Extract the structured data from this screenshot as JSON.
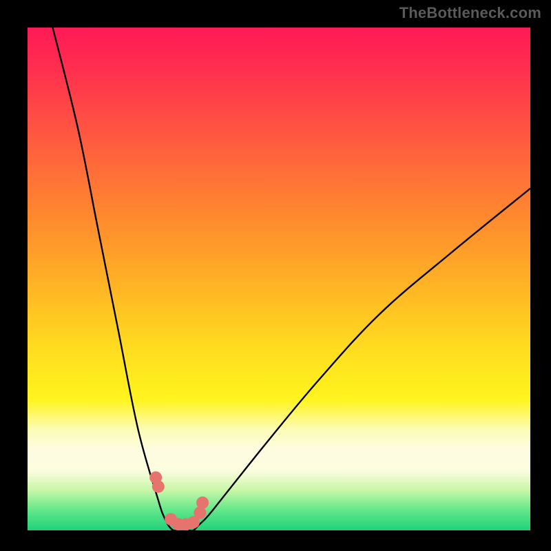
{
  "watermark": "TheBottleneck.com",
  "colors": {
    "background": "#000000",
    "curve_stroke": "#000000",
    "marker_fill": "#e7736e",
    "gradient_top": "#ff1a55",
    "gradient_bottom": "#1fd27a"
  },
  "chart_data": {
    "type": "line",
    "title": "",
    "xlabel": "",
    "ylabel": "",
    "xlim": [
      0,
      100
    ],
    "ylim": [
      0,
      100
    ],
    "series": [
      {
        "name": "left-curve",
        "x": [
          5,
          10,
          14,
          18,
          22,
          26,
          27,
          28,
          29,
          30
        ],
        "y": [
          100,
          80,
          60,
          40,
          20,
          6,
          3,
          1,
          0,
          0
        ]
      },
      {
        "name": "right-curve",
        "x": [
          32,
          33,
          34,
          36,
          40,
          48,
          58,
          70,
          84,
          100
        ],
        "y": [
          0,
          0,
          1,
          3,
          8,
          18,
          30,
          43,
          55,
          68
        ]
      }
    ],
    "markers": {
      "name": "data-points",
      "x": [
        25.5,
        26.0,
        28.5,
        30.0,
        31.5,
        33.0,
        34.3,
        34.8
      ],
      "y": [
        10.5,
        8.7,
        2.2,
        1.2,
        1.2,
        1.6,
        3.5,
        5.5
      ]
    }
  }
}
